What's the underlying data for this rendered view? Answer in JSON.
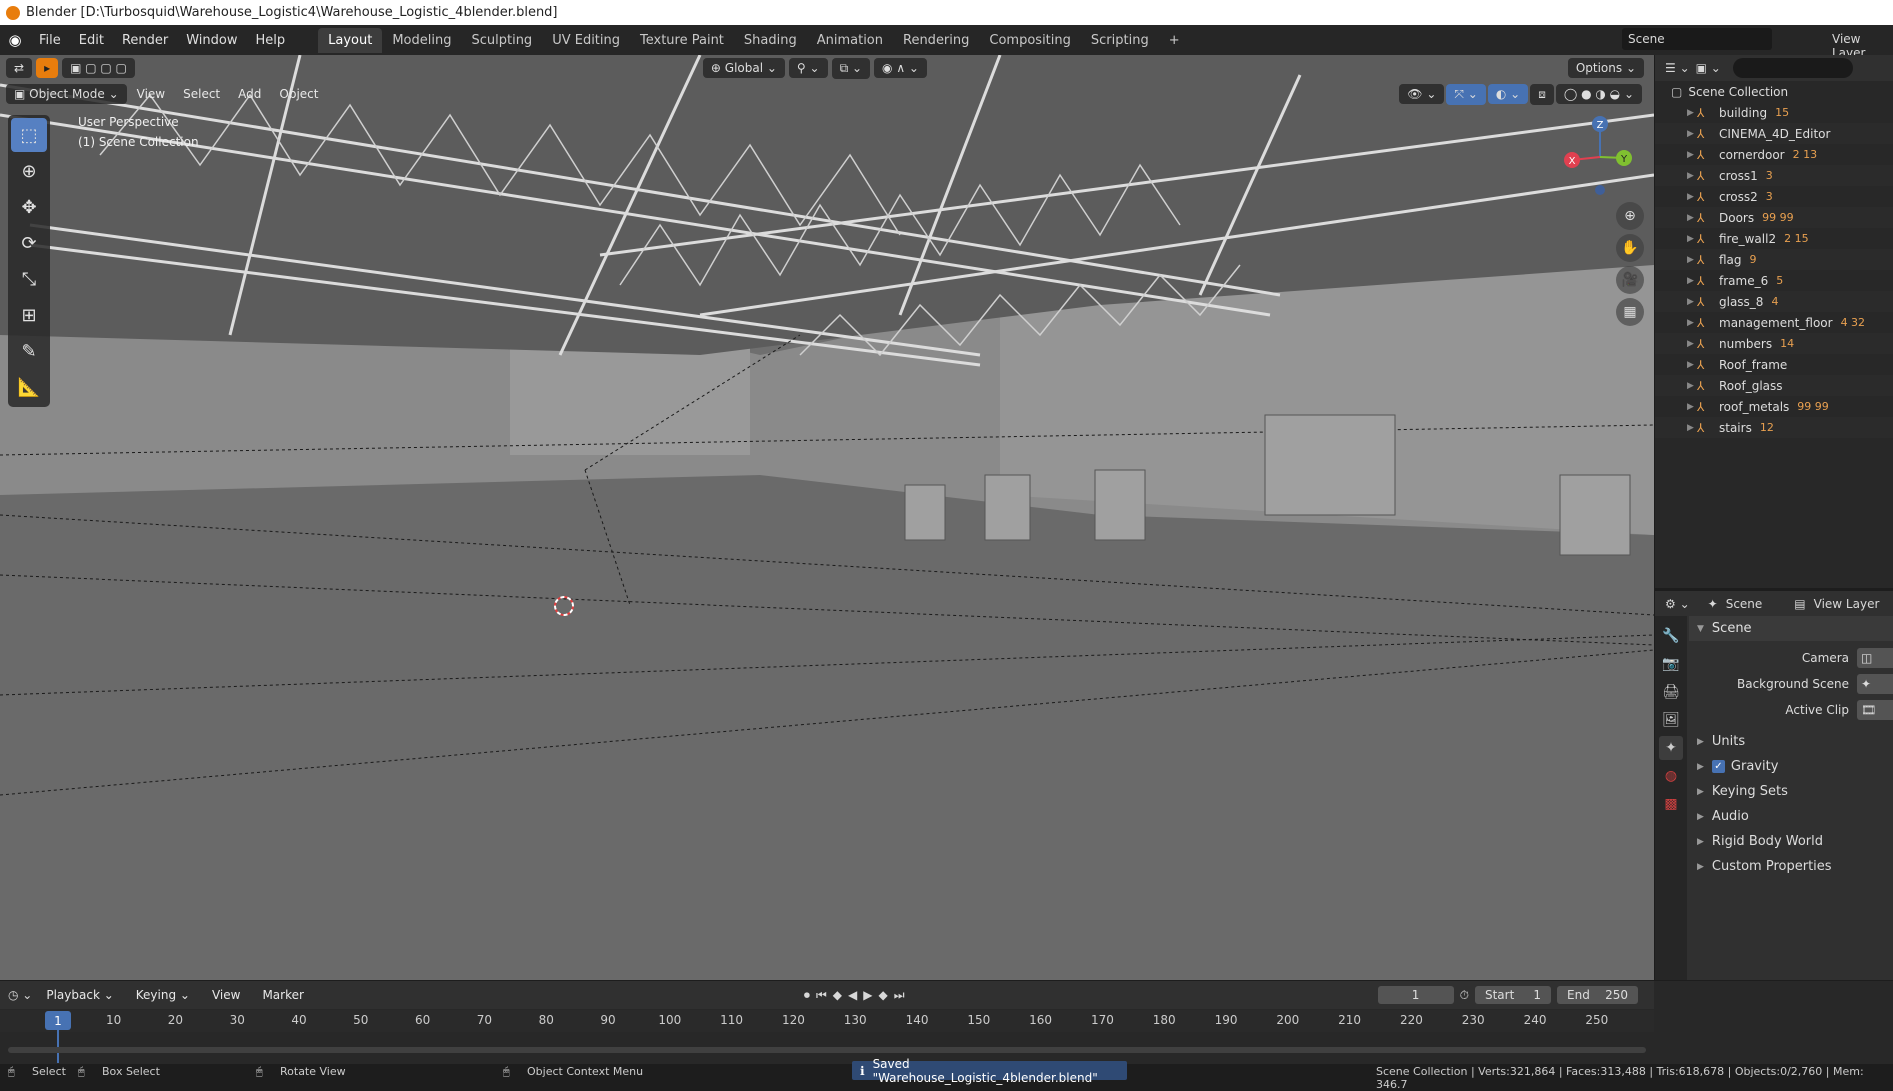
{
  "window": {
    "title": "Blender [D:\\Turbosquid\\Warehouse_Logistic4\\Warehouse_Logistic_4blender.blend]"
  },
  "menu": [
    "File",
    "Edit",
    "Render",
    "Window",
    "Help"
  ],
  "workspaces": [
    "Layout",
    "Modeling",
    "Sculpting",
    "UV Editing",
    "Texture Paint",
    "Shading",
    "Animation",
    "Rendering",
    "Compositing",
    "Scripting"
  ],
  "header": {
    "scene": "Scene",
    "view_layer": "View Layer"
  },
  "viewport": {
    "mode": "Object Mode",
    "menus": [
      "View",
      "Select",
      "Add",
      "Object"
    ],
    "orientation": "Global",
    "options_label": "Options",
    "perspective": "User Perspective",
    "collection": "(1) Scene Collection",
    "gizmo": {
      "x": "X",
      "y": "Y",
      "z": "Z"
    }
  },
  "outliner": {
    "root": "Scene Collection",
    "items": [
      {
        "name": "building",
        "badge": "15"
      },
      {
        "name": "CINEMA_4D_Editor",
        "badge": ""
      },
      {
        "name": "cornerdoor",
        "badge": "2 13"
      },
      {
        "name": "cross1",
        "badge": "3"
      },
      {
        "name": "cross2",
        "badge": "3"
      },
      {
        "name": "Doors",
        "badge": "99 99"
      },
      {
        "name": "fire_wall2",
        "badge": "2 15"
      },
      {
        "name": "flag",
        "badge": "9"
      },
      {
        "name": "frame_6",
        "badge": "5"
      },
      {
        "name": "glass_8",
        "badge": "4"
      },
      {
        "name": "management_floor",
        "badge": "4 32"
      },
      {
        "name": "numbers",
        "badge": "14"
      },
      {
        "name": "Roof_frame",
        "badge": ""
      },
      {
        "name": "Roof_glass",
        "badge": ""
      },
      {
        "name": "roof_metals",
        "badge": "99 99"
      },
      {
        "name": "stairs",
        "badge": "12"
      }
    ]
  },
  "properties": {
    "scene_tab": "Scene",
    "view_layer_tab": "View Layer",
    "panel": "Scene",
    "fields": [
      {
        "label": "Camera"
      },
      {
        "label": "Background Scene"
      },
      {
        "label": "Active Clip"
      }
    ],
    "subpanels": [
      "Units",
      "Gravity",
      "Keying Sets",
      "Audio",
      "Rigid Body World",
      "Custom Properties"
    ]
  },
  "timeline": {
    "menus": [
      "Playback",
      "Keying",
      "View",
      "Marker"
    ],
    "current_frame": "1",
    "start_label": "Start",
    "start": "1",
    "end_label": "End",
    "end": "250",
    "ticks": [
      "1",
      "10",
      "20",
      "30",
      "40",
      "50",
      "60",
      "70",
      "80",
      "90",
      "100",
      "110",
      "120",
      "130",
      "140",
      "150",
      "160",
      "170",
      "180",
      "190",
      "200",
      "210",
      "220",
      "230",
      "240",
      "250"
    ]
  },
  "status": {
    "select": "Select",
    "box_select": "Box Select",
    "rotate_view": "Rotate View",
    "context_menu": "Object Context Menu",
    "saved": "Saved \"Warehouse_Logistic_4blender.blend\"",
    "stats": "Scene Collection | Verts:321,864 | Faces:313,488 | Tris:618,678 | Objects:0/2,760 | Mem: 346.7"
  },
  "colors": {
    "accent": "#4772b3",
    "object_icon": "#e8a050",
    "viewport_bg": "#6d6d6d"
  }
}
